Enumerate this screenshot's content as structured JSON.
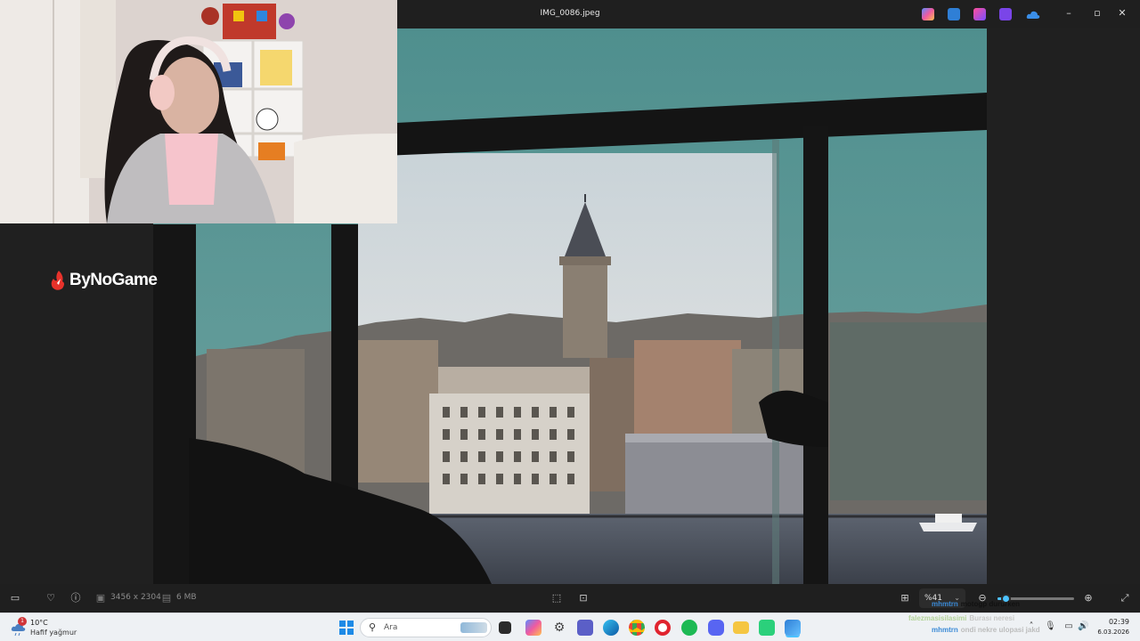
{
  "window": {
    "title": "IMG_0086.jpeg",
    "controls": [
      "minimize",
      "maximize",
      "close"
    ]
  },
  "brand": {
    "name": "ByNoGame"
  },
  "viewer_toolbar": {
    "dimensions": "3456 x 2304",
    "file_size": "6 MB",
    "zoom": "%41",
    "zoom_level_fraction": 0.1
  },
  "chat": [
    {
      "user": "mhmtrn",
      "message": "motogp dururken"
    },
    {
      "user": "falezmasisilasimi",
      "message": "Burası neresi"
    },
    {
      "user": "mhmtrn",
      "message": "ondi nekre ulopasi jakd"
    }
  ],
  "taskbar": {
    "weather_temp": "10°C",
    "weather_desc": "Hafif yağmur",
    "weather_badge": "1",
    "search_placeholder": "Ara",
    "time": "02:39",
    "date": "6.03.2026"
  },
  "colors": {
    "accent": "#4cc2ff",
    "viewer_bg": "#1f1f1f",
    "taskbar_bg": "#eef1f4"
  }
}
